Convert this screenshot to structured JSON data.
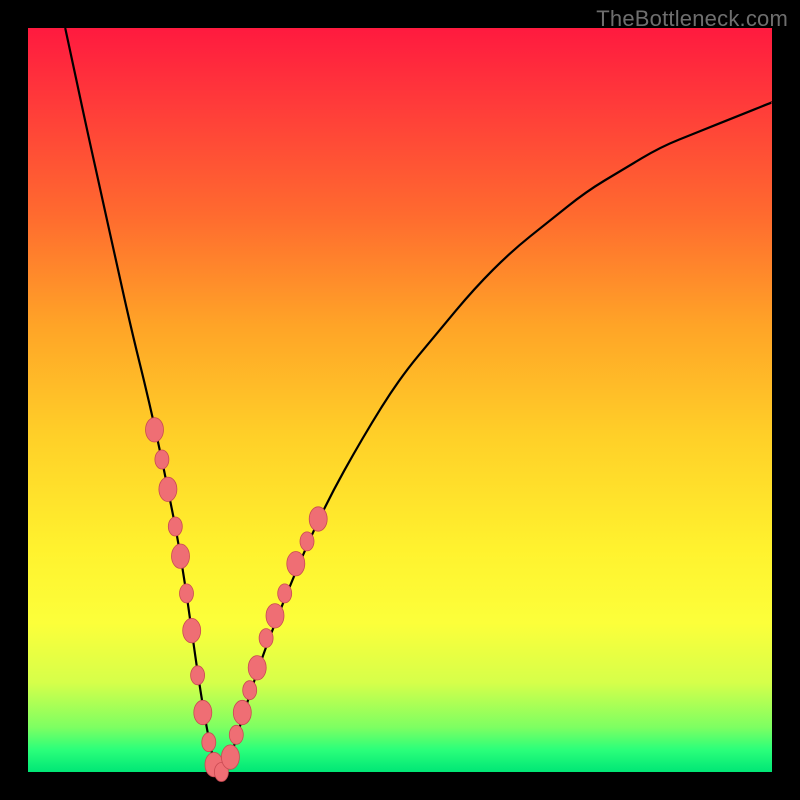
{
  "watermark": "TheBottleneck.com",
  "colors": {
    "background": "#000000",
    "gradient_top": "#ff1a3f",
    "gradient_bottom": "#00e676",
    "curve": "#000000",
    "bead_fill": "#ef6e74",
    "bead_stroke": "#c94a52"
  },
  "chart_data": {
    "type": "line",
    "title": "",
    "xlabel": "",
    "ylabel": "",
    "xlim": [
      0,
      100
    ],
    "ylim": [
      0,
      100
    ],
    "grid": false,
    "legend": false,
    "series": [
      {
        "name": "bottleneck-curve",
        "x": [
          5,
          8,
          10,
          12,
          14,
          16,
          18,
          19,
          20,
          21,
          22,
          23,
          24,
          25,
          27,
          29,
          32,
          36,
          40,
          45,
          50,
          55,
          60,
          65,
          70,
          75,
          80,
          85,
          90,
          95,
          100
        ],
        "values": [
          100,
          86,
          77,
          68,
          59,
          51,
          42,
          37,
          32,
          26,
          19,
          12,
          6,
          1,
          1,
          8,
          17,
          27,
          36,
          45,
          53,
          59,
          65,
          70,
          74,
          78,
          81,
          84,
          86,
          88,
          90
        ]
      }
    ],
    "markers": [
      {
        "x": 17.0,
        "y": 46,
        "r": 9
      },
      {
        "x": 18.0,
        "y": 42,
        "r": 7
      },
      {
        "x": 18.8,
        "y": 38,
        "r": 9
      },
      {
        "x": 19.8,
        "y": 33,
        "r": 7
      },
      {
        "x": 20.5,
        "y": 29,
        "r": 9
      },
      {
        "x": 21.3,
        "y": 24,
        "r": 7
      },
      {
        "x": 22.0,
        "y": 19,
        "r": 9
      },
      {
        "x": 22.8,
        "y": 13,
        "r": 7
      },
      {
        "x": 23.5,
        "y": 8,
        "r": 9
      },
      {
        "x": 24.3,
        "y": 4,
        "r": 7
      },
      {
        "x": 25.0,
        "y": 1,
        "r": 9
      },
      {
        "x": 26.0,
        "y": 0,
        "r": 7
      },
      {
        "x": 27.2,
        "y": 2,
        "r": 9
      },
      {
        "x": 28.0,
        "y": 5,
        "r": 7
      },
      {
        "x": 28.8,
        "y": 8,
        "r": 9
      },
      {
        "x": 29.8,
        "y": 11,
        "r": 7
      },
      {
        "x": 30.8,
        "y": 14,
        "r": 9
      },
      {
        "x": 32.0,
        "y": 18,
        "r": 7
      },
      {
        "x": 33.2,
        "y": 21,
        "r": 9
      },
      {
        "x": 34.5,
        "y": 24,
        "r": 7
      },
      {
        "x": 36.0,
        "y": 28,
        "r": 9
      },
      {
        "x": 37.5,
        "y": 31,
        "r": 7
      },
      {
        "x": 39.0,
        "y": 34,
        "r": 9
      }
    ]
  }
}
